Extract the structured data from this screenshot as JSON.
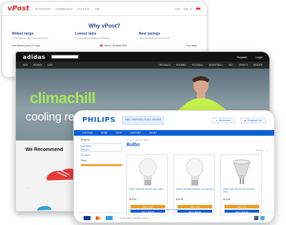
{
  "vpost": {
    "logo": "vPost",
    "nav": [
      "My Shipments",
      "Shopping guide",
      "Buy & Ship",
      "Help"
    ],
    "top_right": [
      "Login",
      "Sign up"
    ],
    "heading": "Why vPost?",
    "features": [
      {
        "title": "Widest range",
        "desc": "of international online stores and brands"
      },
      {
        "title": "Lowest rates",
        "desc": "for international shipping and delivery"
      },
      {
        "title": "Best savings",
        "desc": "with consolidation of your parcels"
      }
    ],
    "bottom": {
      "left": "Fast delivery from 3-5 days",
      "call_label": "Call us",
      "call_number": "+65 6845 9000",
      "right": "Fan deals"
    }
  },
  "adidas": {
    "logo": "adidas",
    "top_right": [
      "Register",
      "Login"
    ],
    "nav": [
      "MEN",
      "WOMEN",
      "KIDS",
      "ORIGINALS",
      "RUNNING",
      "FOOTBALL",
      "BASKETBALL",
      "NEO",
      "SPORTS",
      "BRANDS"
    ],
    "hero_title": "climachill",
    "hero_subtitle": "cooling revolution",
    "recommend_title": "We Recommend"
  },
  "philips": {
    "logo": "PHILIPS",
    "promo": "FREE SHIPPING ON ALL ORDERS",
    "top_right": [
      "My Account",
      "Shopping Cart"
    ],
    "nav": [
      "LIGHTING",
      "HOME",
      "SHOP",
      "SUPPORT",
      "ABOUT"
    ],
    "crumb": "Home > Lighting > Bulbs",
    "heading": "Bulbs",
    "sort_label": "Sort by:",
    "sidebar": {
      "title": "Shop by",
      "items": [
        "LED Bulbs",
        "Halogen",
        "Spotlights"
      ],
      "price_label": "Price"
    },
    "products": [
      {
        "name": "Philips LED bulb 6W E27 warm white",
        "price": "$19.90"
      },
      {
        "name": "Philips LED bulb 9.5W E27 cool daylight",
        "price": "$24.90"
      },
      {
        "name": "Philips LED spot GU10 4.5W warm white",
        "price": "$14.90"
      }
    ],
    "buy_label": "Add to Cart",
    "wish_label": "Add to Wishlist",
    "footer_links": "About Us | Terms & Conditions | Privacy Policy | Contact",
    "footer_text": "© 2015 Philips. All rights reserved."
  },
  "colors": {
    "vpost_red": "#d8232a",
    "vpost_blue": "#2a3f8a",
    "adidas_black": "#111111",
    "climachill_green": "#a9e85a",
    "philips_blue": "#0b5ed7",
    "philips_orange": "#f29b1d"
  }
}
